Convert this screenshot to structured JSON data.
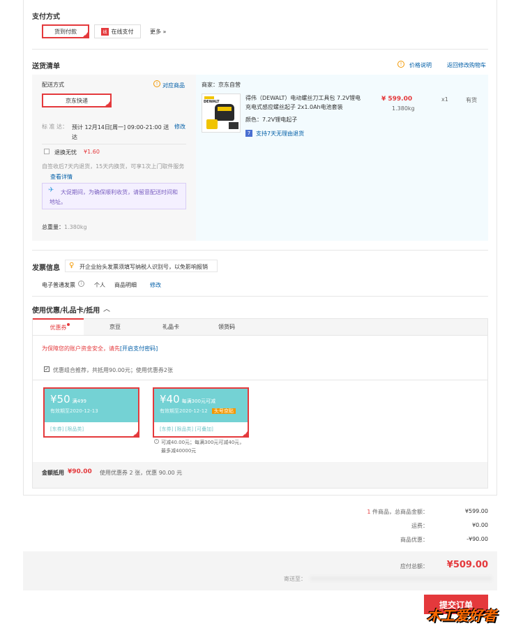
{
  "payment": {
    "title": "支付方式",
    "cod": "货到付款",
    "online_icon": "线",
    "online": "在线支付",
    "more": "更多 »"
  },
  "shipping": {
    "title": "送货清单",
    "price_note": "价格说明",
    "back_to_cart": "返回修改购物车",
    "method_label": "配送方式",
    "match_goods": "对应商品",
    "carrier": "京东快递",
    "eta_label": "标 准 达：",
    "eta_value": "预计 12月14日[周一] 09:00-21:00 送达",
    "modify": "修改",
    "worry_free": "退换无忧",
    "worry_price": "¥1.60",
    "worry_desc": "自签收后7天内退货，15天内换货，可享1次上门取件服务",
    "view_detail": "查看详情",
    "notice": "大促期间，为确保顺利收货，请留意配送时间和地址。",
    "weight_label": "总重量：",
    "weight_value": "1.380kg"
  },
  "product": {
    "seller": "商家：京东自营",
    "name": "得伟（DEWALT）电动螺丝刀工具包 7.2V锂电充电式感应螺丝起子 2x1.0Ah电池套装",
    "color": "颜色：7.2V锂电起子",
    "return_policy": "支持7天无理由退货",
    "price": "¥ 599.00",
    "weight": "1.380kg",
    "qty": "x1",
    "stock": "有货",
    "img_brand": "DEWALT"
  },
  "invoice": {
    "title": "发票信息",
    "tip": "开企业抬头发票须填写纳税人识别号，以免影响报销",
    "type": "电子普通发票",
    "who": "个人",
    "content": "商品明细",
    "modify": "修改"
  },
  "discount": {
    "title": "使用优惠/礼品卡/抵用",
    "tabs": [
      "优惠券",
      "京豆",
      "礼品卡",
      "领货码"
    ],
    "security_tip": "为保障您的账户资金安全，请先",
    "security_link": "[开启支付密码]",
    "combo": "优惠组合推荐，共抵用90.00元；使用优惠券2张",
    "coupons": [
      {
        "amount": "¥50",
        "cond": "满499",
        "expire": "有效期至2020-12-13",
        "tags": "[东券]  [限品类]",
        "badge": ""
      },
      {
        "amount": "¥40",
        "cond": "每满300元可减",
        "expire": "有效期至2020-12-12",
        "tags": "[东券]  [限品类]  [可叠加]",
        "badge": "头号京贴"
      }
    ],
    "coupon2_note": "可减40.00元；每满300元可减40元，最多减40000元",
    "total_label": "金额抵用",
    "total_value": "¥90.00",
    "total_desc": "使用优惠券 2 张，优惠 90.00 元"
  },
  "summary": {
    "count_prefix": "1",
    "count_label": "件商品，总商品金额：",
    "goods_total": "¥599.00",
    "freight_label": "运费：",
    "freight": "¥0.00",
    "discount_label": "商品优惠：",
    "discount": "-¥90.00",
    "payable_label": "应付总额：",
    "payable": "¥509.00",
    "ship_to": "寄送至：",
    "submit": "提交订单"
  },
  "watermark": "木工爱好者",
  "colors": {
    "accent": "#e4393c",
    "coupon": "#74d2d4",
    "panel": "#f3fbfe"
  }
}
